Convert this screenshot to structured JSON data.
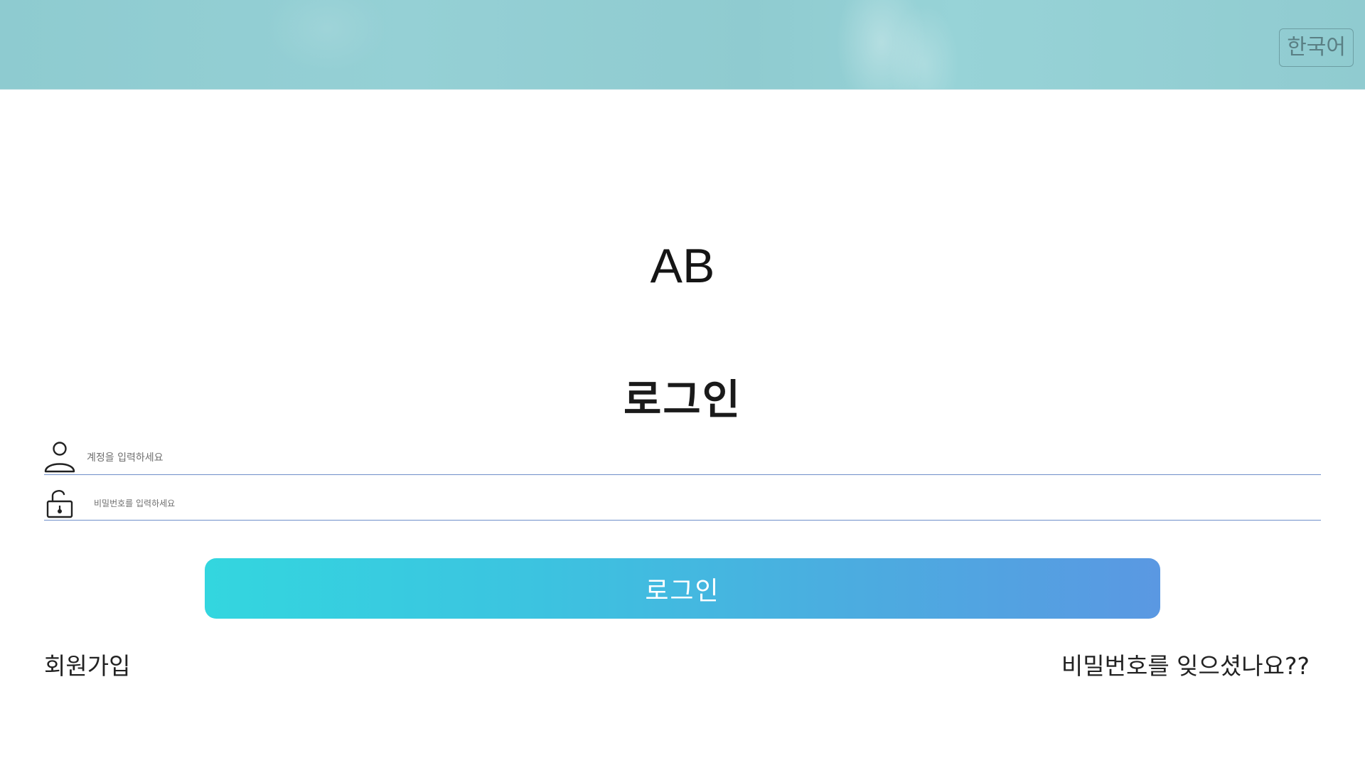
{
  "header": {
    "language_label": "한국어"
  },
  "brand": {
    "logo_text": "AB"
  },
  "login_form": {
    "heading": "로그인",
    "account_field": {
      "placeholder": "계정을 입력하세요",
      "value": "",
      "icon": "user-icon"
    },
    "password_field": {
      "placeholder": "비밀번호를 입력하세요",
      "value": "",
      "icon": "lock-icon"
    },
    "submit_label": "로그인"
  },
  "links": {
    "signup": "회원가입",
    "forgot_password": "비밀번호를 잊으셨나요??"
  },
  "colors": {
    "banner": "#8ecbd0",
    "button_gradient_start": "#33d6df",
    "button_gradient_end": "#5a98e2",
    "field_underline": "#6f8fc9"
  }
}
